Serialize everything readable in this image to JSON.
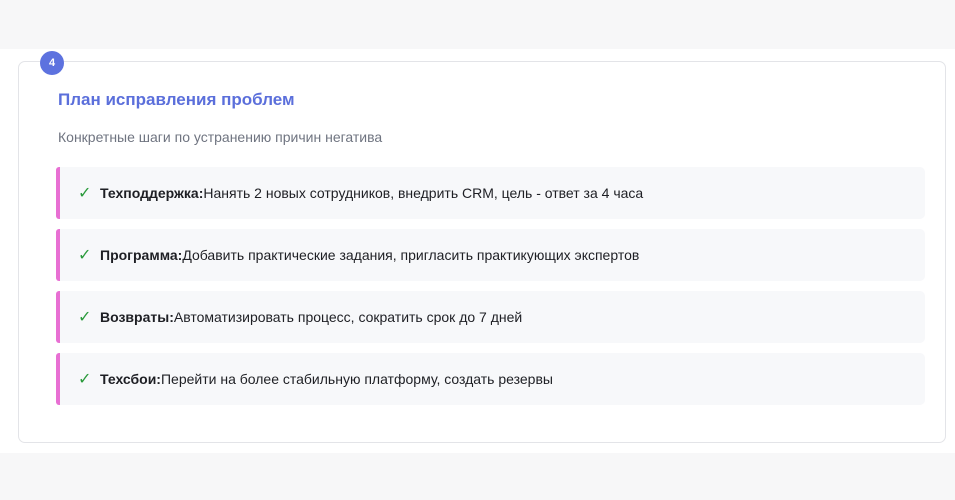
{
  "step": {
    "number": "4"
  },
  "card": {
    "title": "План исправления проблем",
    "subtitle": "Конкретные шаги по устранению причин негатива"
  },
  "items": [
    {
      "label": "Техподдержка:",
      "text": "Нанять 2 новых сотрудников, внедрить CRM, цель - ответ за 4 часа",
      "icon": "check-icon",
      "mark": "✓"
    },
    {
      "label": "Программа:",
      "text": "Добавить практические задания, пригласить практикующих экспертов",
      "icon": "check-icon",
      "mark": "✓"
    },
    {
      "label": "Возвраты:",
      "text": "Автоматизировать процесс, сократить срок до 7 дней",
      "icon": "check-icon",
      "mark": "✓"
    },
    {
      "label": "Техсбои:",
      "text": "Перейти на более стабильную платформу, создать резервы",
      "icon": "check-icon",
      "mark": "✓"
    }
  ],
  "colors": {
    "accent": "#5b6fdb",
    "item_border": "#e86fd3",
    "check": "#2a9a3b",
    "item_background": "#f7f8fa"
  }
}
